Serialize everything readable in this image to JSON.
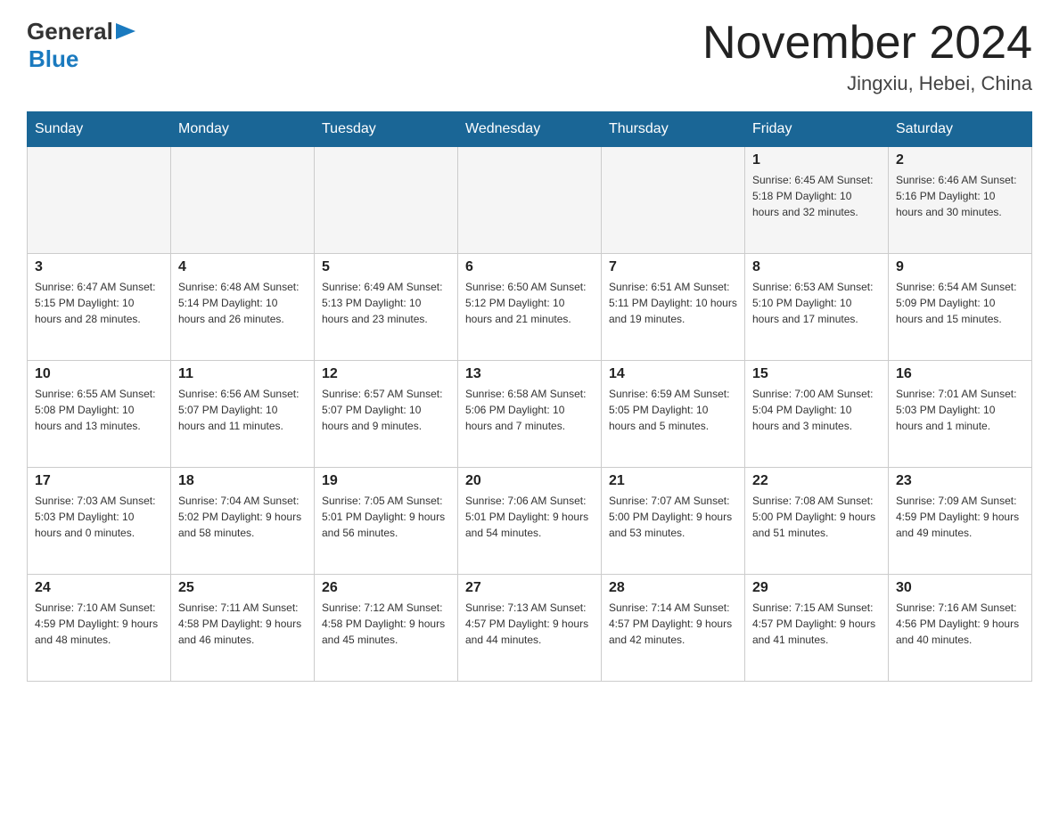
{
  "logo": {
    "general": "General",
    "blue": "Blue"
  },
  "title": "November 2024",
  "subtitle": "Jingxiu, Hebei, China",
  "weekdays": [
    "Sunday",
    "Monday",
    "Tuesday",
    "Wednesday",
    "Thursday",
    "Friday",
    "Saturday"
  ],
  "weeks": [
    [
      {
        "day": "",
        "info": ""
      },
      {
        "day": "",
        "info": ""
      },
      {
        "day": "",
        "info": ""
      },
      {
        "day": "",
        "info": ""
      },
      {
        "day": "",
        "info": ""
      },
      {
        "day": "1",
        "info": "Sunrise: 6:45 AM\nSunset: 5:18 PM\nDaylight: 10 hours\nand 32 minutes."
      },
      {
        "day": "2",
        "info": "Sunrise: 6:46 AM\nSunset: 5:16 PM\nDaylight: 10 hours\nand 30 minutes."
      }
    ],
    [
      {
        "day": "3",
        "info": "Sunrise: 6:47 AM\nSunset: 5:15 PM\nDaylight: 10 hours\nand 28 minutes."
      },
      {
        "day": "4",
        "info": "Sunrise: 6:48 AM\nSunset: 5:14 PM\nDaylight: 10 hours\nand 26 minutes."
      },
      {
        "day": "5",
        "info": "Sunrise: 6:49 AM\nSunset: 5:13 PM\nDaylight: 10 hours\nand 23 minutes."
      },
      {
        "day": "6",
        "info": "Sunrise: 6:50 AM\nSunset: 5:12 PM\nDaylight: 10 hours\nand 21 minutes."
      },
      {
        "day": "7",
        "info": "Sunrise: 6:51 AM\nSunset: 5:11 PM\nDaylight: 10 hours\nand 19 minutes."
      },
      {
        "day": "8",
        "info": "Sunrise: 6:53 AM\nSunset: 5:10 PM\nDaylight: 10 hours\nand 17 minutes."
      },
      {
        "day": "9",
        "info": "Sunrise: 6:54 AM\nSunset: 5:09 PM\nDaylight: 10 hours\nand 15 minutes."
      }
    ],
    [
      {
        "day": "10",
        "info": "Sunrise: 6:55 AM\nSunset: 5:08 PM\nDaylight: 10 hours\nand 13 minutes."
      },
      {
        "day": "11",
        "info": "Sunrise: 6:56 AM\nSunset: 5:07 PM\nDaylight: 10 hours\nand 11 minutes."
      },
      {
        "day": "12",
        "info": "Sunrise: 6:57 AM\nSunset: 5:07 PM\nDaylight: 10 hours\nand 9 minutes."
      },
      {
        "day": "13",
        "info": "Sunrise: 6:58 AM\nSunset: 5:06 PM\nDaylight: 10 hours\nand 7 minutes."
      },
      {
        "day": "14",
        "info": "Sunrise: 6:59 AM\nSunset: 5:05 PM\nDaylight: 10 hours\nand 5 minutes."
      },
      {
        "day": "15",
        "info": "Sunrise: 7:00 AM\nSunset: 5:04 PM\nDaylight: 10 hours\nand 3 minutes."
      },
      {
        "day": "16",
        "info": "Sunrise: 7:01 AM\nSunset: 5:03 PM\nDaylight: 10 hours\nand 1 minute."
      }
    ],
    [
      {
        "day": "17",
        "info": "Sunrise: 7:03 AM\nSunset: 5:03 PM\nDaylight: 10 hours\nand 0 minutes."
      },
      {
        "day": "18",
        "info": "Sunrise: 7:04 AM\nSunset: 5:02 PM\nDaylight: 9 hours\nand 58 minutes."
      },
      {
        "day": "19",
        "info": "Sunrise: 7:05 AM\nSunset: 5:01 PM\nDaylight: 9 hours\nand 56 minutes."
      },
      {
        "day": "20",
        "info": "Sunrise: 7:06 AM\nSunset: 5:01 PM\nDaylight: 9 hours\nand 54 minutes."
      },
      {
        "day": "21",
        "info": "Sunrise: 7:07 AM\nSunset: 5:00 PM\nDaylight: 9 hours\nand 53 minutes."
      },
      {
        "day": "22",
        "info": "Sunrise: 7:08 AM\nSunset: 5:00 PM\nDaylight: 9 hours\nand 51 minutes."
      },
      {
        "day": "23",
        "info": "Sunrise: 7:09 AM\nSunset: 4:59 PM\nDaylight: 9 hours\nand 49 minutes."
      }
    ],
    [
      {
        "day": "24",
        "info": "Sunrise: 7:10 AM\nSunset: 4:59 PM\nDaylight: 9 hours\nand 48 minutes."
      },
      {
        "day": "25",
        "info": "Sunrise: 7:11 AM\nSunset: 4:58 PM\nDaylight: 9 hours\nand 46 minutes."
      },
      {
        "day": "26",
        "info": "Sunrise: 7:12 AM\nSunset: 4:58 PM\nDaylight: 9 hours\nand 45 minutes."
      },
      {
        "day": "27",
        "info": "Sunrise: 7:13 AM\nSunset: 4:57 PM\nDaylight: 9 hours\nand 44 minutes."
      },
      {
        "day": "28",
        "info": "Sunrise: 7:14 AM\nSunset: 4:57 PM\nDaylight: 9 hours\nand 42 minutes."
      },
      {
        "day": "29",
        "info": "Sunrise: 7:15 AM\nSunset: 4:57 PM\nDaylight: 9 hours\nand 41 minutes."
      },
      {
        "day": "30",
        "info": "Sunrise: 7:16 AM\nSunset: 4:56 PM\nDaylight: 9 hours\nand 40 minutes."
      }
    ]
  ]
}
